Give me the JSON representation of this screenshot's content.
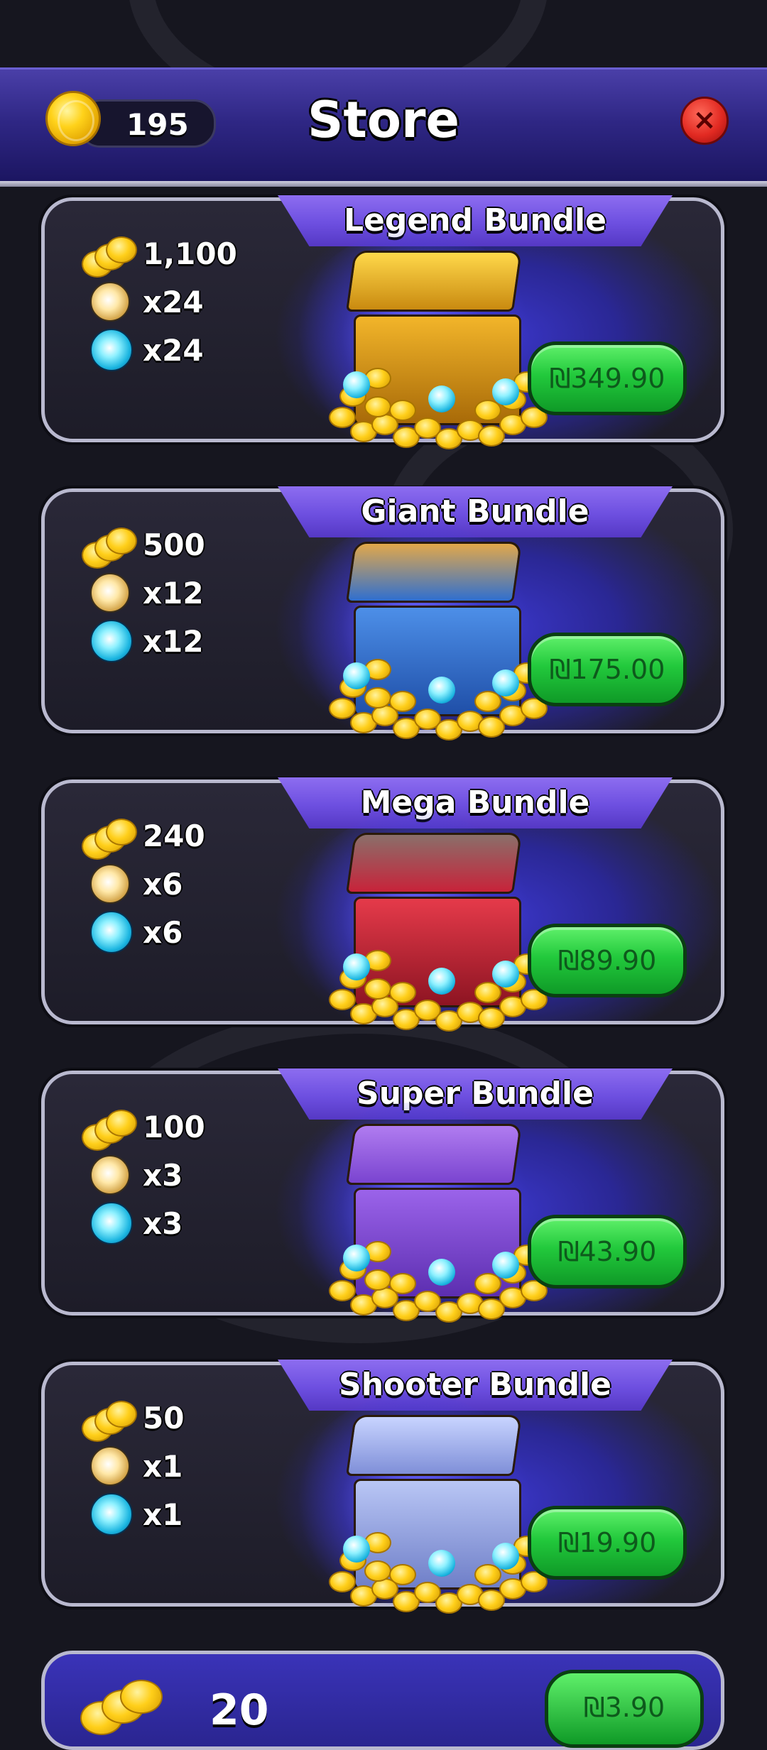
{
  "header": {
    "coins": "195",
    "title": "Store",
    "close_label": "×"
  },
  "colors": {
    "header": "#2f2785",
    "tab": "#6d4fe0",
    "price_button": "#22c93c",
    "close_button": "#e22a22"
  },
  "bundles": [
    {
      "name": "Legend Bundle",
      "coins": "1,100",
      "suns": "x24",
      "orbs": "x24",
      "price": "₪349.90",
      "chest_color": "gold"
    },
    {
      "name": "Giant Bundle",
      "coins": "500",
      "suns": "x12",
      "orbs": "x12",
      "price": "₪175.00",
      "chest_color": "blue"
    },
    {
      "name": "Mega Bundle",
      "coins": "240",
      "suns": "x6",
      "orbs": "x6",
      "price": "₪89.90",
      "chest_color": "red"
    },
    {
      "name": "Super Bundle",
      "coins": "100",
      "suns": "x3",
      "orbs": "x3",
      "price": "₪43.90",
      "chest_color": "purple"
    },
    {
      "name": "Shooter Bundle",
      "coins": "50",
      "suns": "x1",
      "orbs": "x1",
      "price": "₪19.90",
      "chest_color": "silver"
    }
  ],
  "partial_bundle": {
    "coins": "20",
    "price": "₪3.90"
  },
  "icons": {
    "coin": "coin-icon",
    "sun": "sun-orb-icon",
    "orb": "blue-orb-icon",
    "close": "close-icon",
    "chest": "treasure-chest-icon"
  }
}
